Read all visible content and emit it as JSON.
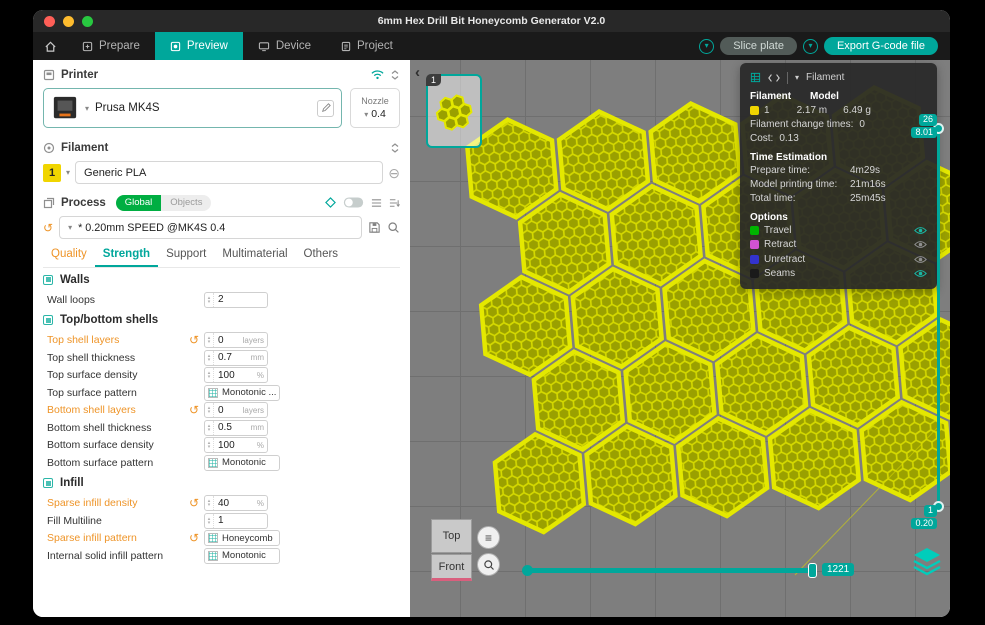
{
  "window": {
    "title": "6mm Hex Drill Bit Honeycomb Generator V2.0"
  },
  "nav": {
    "tabs": [
      {
        "label": "Prepare",
        "active": false
      },
      {
        "label": "Preview",
        "active": true
      },
      {
        "label": "Device",
        "active": false
      },
      {
        "label": "Project",
        "active": false
      }
    ],
    "slice_label": "Slice plate",
    "export_label": "Export G-code file"
  },
  "sidebar": {
    "printer": {
      "section": "Printer",
      "name": "Prusa MK4S",
      "nozzle_label": "Nozzle",
      "nozzle_value": "0.4"
    },
    "filament": {
      "section": "Filament",
      "slot": "1",
      "name": "Generic PLA"
    },
    "process": {
      "section": "Process",
      "scope_global": "Global",
      "scope_objects": "Objects",
      "preset": "* 0.20mm SPEED @MK4S 0.4"
    },
    "tabs": [
      {
        "label": "Quality",
        "state": "modified"
      },
      {
        "label": "Strength",
        "state": "active"
      },
      {
        "label": "Support",
        "state": "normal"
      },
      {
        "label": "Multimaterial",
        "state": "normal"
      },
      {
        "label": "Others",
        "state": "normal"
      }
    ],
    "groups": [
      {
        "title": "Walls",
        "rows": [
          {
            "label": "Wall loops",
            "value": "2",
            "unit": "",
            "type": "input",
            "modified": false
          }
        ]
      },
      {
        "title": "Top/bottom shells",
        "rows": [
          {
            "label": "Top shell layers",
            "value": "0",
            "unit": "layers",
            "type": "input",
            "modified": true
          },
          {
            "label": "Top shell thickness",
            "value": "0.7",
            "unit": "mm",
            "type": "input",
            "modified": false
          },
          {
            "label": "Top surface density",
            "value": "100",
            "unit": "%",
            "type": "input",
            "modified": false
          },
          {
            "label": "Top surface pattern",
            "value": "Monotonic ...",
            "type": "select",
            "modified": false
          },
          {
            "label": "Bottom shell layers",
            "value": "0",
            "unit": "layers",
            "type": "input",
            "modified": true
          },
          {
            "label": "Bottom shell thickness",
            "value": "0.5",
            "unit": "mm",
            "type": "input",
            "modified": false
          },
          {
            "label": "Bottom surface density",
            "value": "100",
            "unit": "%",
            "type": "input",
            "modified": false
          },
          {
            "label": "Bottom surface pattern",
            "value": "Monotonic",
            "type": "select",
            "modified": false
          }
        ]
      },
      {
        "title": "Infill",
        "rows": [
          {
            "label": "Sparse infill density",
            "value": "40",
            "unit": "%",
            "type": "input",
            "modified": true
          },
          {
            "label": "Fill Multiline",
            "value": "1",
            "unit": "",
            "type": "input",
            "modified": false
          },
          {
            "label": "Sparse infill pattern",
            "value": "Honeycomb",
            "type": "select",
            "modified": true
          },
          {
            "label": "Internal solid infill pattern",
            "value": "Monotonic",
            "type": "select",
            "modified": false
          }
        ]
      }
    ]
  },
  "viewport": {
    "plate_badge": "1",
    "stats": {
      "header_label": "Filament",
      "col1": "Filament",
      "col2": "Model",
      "row": {
        "index": "1",
        "length": "2.17 m",
        "weight": "6.49 g"
      },
      "change_times_label": "Filament change times:",
      "change_times": "0",
      "cost_label": "Cost:",
      "cost": "0.13",
      "time_section": "Time Estimation",
      "prepare_label": "Prepare time:",
      "prepare": "4m29s",
      "model_label": "Model printing time:",
      "model": "21m16s",
      "total_label": "Total time:",
      "total": "25m45s",
      "options_section": "Options",
      "options": [
        {
          "label": "Travel",
          "color": "#00b400",
          "visible": true
        },
        {
          "label": "Retract",
          "color": "#d253d2",
          "visible": false
        },
        {
          "label": "Unretract",
          "color": "#3333cc",
          "visible": false
        },
        {
          "label": "Seams",
          "color": "#1a1a1a",
          "visible": true
        }
      ]
    },
    "layer_slider": {
      "top_layer": "26",
      "top_height": "8.01",
      "bottom_layer": "1",
      "bottom_height": "0.20"
    },
    "hslider_value": "1221",
    "view_buttons": [
      "Top",
      "Front"
    ]
  },
  "colors": {
    "accent": "#00a79b",
    "green": "#00ae42",
    "modified": "#ee9428",
    "filamentYellow": "#f0d500",
    "modelWall": "#e4e800",
    "modelFill": "#9aa000",
    "modelLine": "#d5d900",
    "viewportBg": "#7e7e7e",
    "gridLine": "#6f6f6f"
  }
}
